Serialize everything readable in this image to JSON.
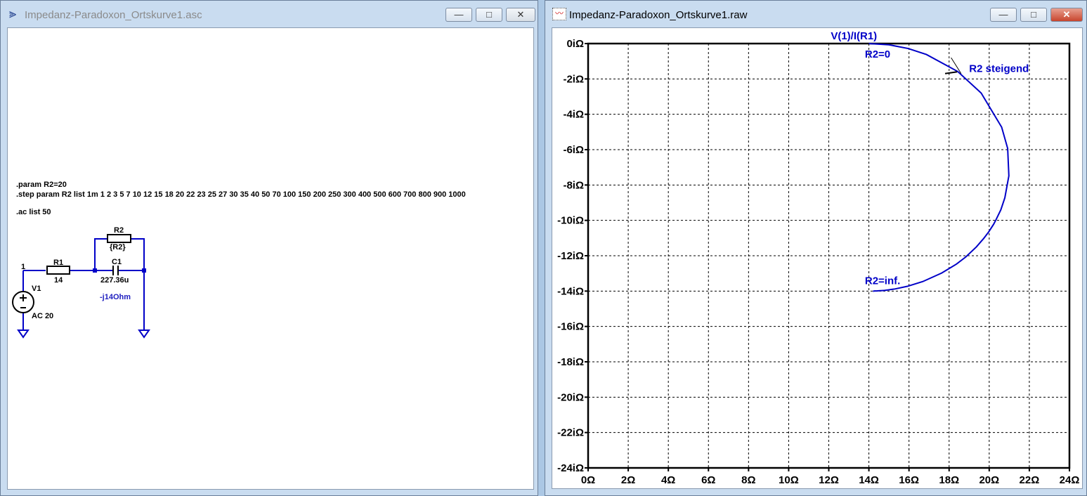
{
  "schematic_window": {
    "title": "Impedanz-Paradoxon_Ortskurve1.asc",
    "directives": [
      ".param R2=20",
      ".step param R2 list 1m 1 2 3 5 7 10 12 15 18 20 22 23 25 27 30 35 40 50 70 100 150 200 250 300 400 500 600 700 800 900 1000",
      ".ac list 50"
    ],
    "node_label": "1",
    "components": {
      "R1": {
        "name": "R1",
        "value": "14"
      },
      "R2": {
        "name": "R2",
        "value": "{R2}"
      },
      "C1": {
        "name": "C1",
        "value": "227.36u",
        "note": "-j14Ohm"
      },
      "V1": {
        "name": "V1",
        "value": "AC 20"
      }
    },
    "wire_color": "#0000c8"
  },
  "plot_window": {
    "title": "Impedanz-Paradoxon_Ortskurve1.raw",
    "trace_label": "V(1)/I(R1)",
    "annotations": [
      "R2=0",
      "R2 steigend",
      "R2=inf."
    ],
    "trace_color": "#0000c8"
  },
  "window_buttons": {
    "minimize": "—",
    "maximize": "□",
    "close": "✕"
  },
  "chart_data": {
    "type": "line",
    "title": "V(1)/I(R1)",
    "xlim": [
      0,
      24
    ],
    "ylim": [
      -24,
      0
    ],
    "x_ticks": [
      "0Ω",
      "2Ω",
      "4Ω",
      "6Ω",
      "8Ω",
      "10Ω",
      "12Ω",
      "14Ω",
      "16Ω",
      "18Ω",
      "20Ω",
      "22Ω",
      "24Ω"
    ],
    "y_ticks": [
      "0iΩ",
      "-2iΩ",
      "-4iΩ",
      "-6iΩ",
      "-8iΩ",
      "-10iΩ",
      "-12iΩ",
      "-14iΩ",
      "-16iΩ",
      "-18iΩ",
      "-20iΩ",
      "-22iΩ",
      "-24iΩ"
    ],
    "grid": true,
    "series": [
      {
        "name": "V(1)/I(R1)",
        "x": [
          14.0,
          15.0,
          15.96,
          16.87,
          18.43,
          19.6,
          20.62,
          20.92,
          20.98,
          20.78,
          20.58,
          20.34,
          20.22,
          19.97,
          19.72,
          19.36,
          18.83,
          18.37,
          17.63,
          16.69,
          15.92,
          15.3,
          14.98,
          14.78,
          14.65,
          14.49,
          14.39,
          14.33,
          14.28,
          14.25,
          14.22,
          14.2
        ],
        "y": [
          0,
          -0.07,
          -0.28,
          -0.62,
          -1.58,
          -2.8,
          -4.73,
          -5.93,
          -7.48,
          -8.72,
          -9.4,
          -9.96,
          -10.22,
          -10.66,
          -11.03,
          -11.5,
          -12.07,
          -12.47,
          -12.98,
          -13.46,
          -13.73,
          -13.88,
          -13.93,
          -13.96,
          -13.97,
          -13.98,
          -13.99,
          -13.99,
          -13.99,
          -14.0,
          -14.0,
          -14.0
        ]
      }
    ]
  }
}
